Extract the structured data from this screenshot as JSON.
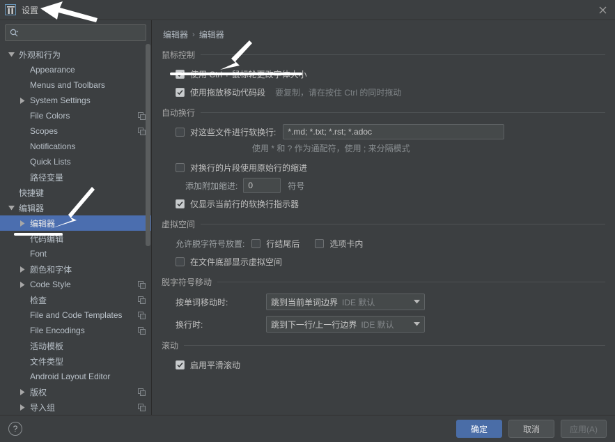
{
  "window": {
    "title": "设置",
    "logo_icon": "jetbrains-logo-icon",
    "close_icon": "close-icon"
  },
  "sidebar": {
    "search": {
      "value": "",
      "placeholder": "",
      "icon": "search-icon"
    },
    "items": [
      {
        "label": "外观和行为",
        "depth": 0,
        "twisty": "down",
        "copy": false
      },
      {
        "label": "Appearance",
        "depth": 1,
        "twisty": "none",
        "copy": false
      },
      {
        "label": "Menus and Toolbars",
        "depth": 1,
        "twisty": "none",
        "copy": false
      },
      {
        "label": "System Settings",
        "depth": 1,
        "twisty": "right",
        "copy": false
      },
      {
        "label": "File Colors",
        "depth": 1,
        "twisty": "none",
        "copy": true
      },
      {
        "label": "Scopes",
        "depth": 1,
        "twisty": "none",
        "copy": true
      },
      {
        "label": "Notifications",
        "depth": 1,
        "twisty": "none",
        "copy": false
      },
      {
        "label": "Quick Lists",
        "depth": 1,
        "twisty": "none",
        "copy": false
      },
      {
        "label": "路径变量",
        "depth": 1,
        "twisty": "none",
        "copy": false
      },
      {
        "label": "快捷键",
        "depth": 0,
        "twisty": "none",
        "copy": false
      },
      {
        "label": "编辑器",
        "depth": 0,
        "twisty": "down",
        "copy": false
      },
      {
        "label": "编辑器",
        "depth": 1,
        "twisty": "right",
        "copy": false,
        "selected": true
      },
      {
        "label": "代码编辑",
        "depth": 1,
        "twisty": "none",
        "copy": false
      },
      {
        "label": "Font",
        "depth": 1,
        "twisty": "none",
        "copy": false
      },
      {
        "label": "颜色和字体",
        "depth": 1,
        "twisty": "right",
        "copy": false
      },
      {
        "label": "Code Style",
        "depth": 1,
        "twisty": "right",
        "copy": true
      },
      {
        "label": "检查",
        "depth": 1,
        "twisty": "none",
        "copy": true
      },
      {
        "label": "File and Code Templates",
        "depth": 1,
        "twisty": "none",
        "copy": true
      },
      {
        "label": "File Encodings",
        "depth": 1,
        "twisty": "none",
        "copy": true
      },
      {
        "label": "活动模板",
        "depth": 1,
        "twisty": "none",
        "copy": false
      },
      {
        "label": "文件类型",
        "depth": 1,
        "twisty": "none",
        "copy": false
      },
      {
        "label": "Android Layout Editor",
        "depth": 1,
        "twisty": "none",
        "copy": false
      },
      {
        "label": "版权",
        "depth": 1,
        "twisty": "right",
        "copy": true
      },
      {
        "label": "导入组",
        "depth": 1,
        "twisty": "right",
        "copy": true
      }
    ]
  },
  "content": {
    "breadcrumb": {
      "root": "编辑器",
      "separator": "›",
      "current": "编辑器"
    },
    "mouse_section": {
      "title": "鼠标控制",
      "ctrl_wheel": {
        "label": "使用 Ctrl + 鼠标轮更改字体大小",
        "checked": true
      },
      "drag_drop": {
        "label": "使用拖放移动代码段",
        "checked": true,
        "hint": "要复制，请在按住 Ctrl 的同时拖动"
      }
    },
    "softwrap_section": {
      "title": "自动换行",
      "soft_wrap_files": {
        "label": "对这些文件进行软换行:",
        "checked": false,
        "value": "*.md; *.txt; *.rst; *.adoc"
      },
      "wildcard_hint": "使用 * 和 ? 作为通配符，使用 ; 来分隔模式",
      "use_original_indent": {
        "label": "对换行的片段使用原始行的缩进",
        "checked": false
      },
      "additional_indent": {
        "label": "添加附加缩进:",
        "value": "0",
        "unit": "符号"
      },
      "show_indicator": {
        "label": "仅显示当前行的软换行指示器",
        "checked": true
      }
    },
    "virtual_space_section": {
      "title": "虚拟空间",
      "allow_caret_label": "允许脱字符号放置:",
      "after_line_end": {
        "label": "行结尾后",
        "checked": false
      },
      "inside_tabs": {
        "label": "选项卡内",
        "checked": false
      },
      "show_virtual_space": {
        "label": "在文件底部显示虚拟空间",
        "checked": false
      }
    },
    "caret_section": {
      "title": "脱字符号移动",
      "word_move": {
        "label": "按单词移动时:",
        "value": "跳到当前单词边界",
        "suffix": "IDE 默认",
        "caret_icon": "chevron-down-icon"
      },
      "line_move": {
        "label": "换行时:",
        "value": "跳到下一行/上一行边界",
        "suffix": "IDE 默认",
        "caret_icon": "chevron-down-icon"
      }
    },
    "scroll_section": {
      "title": "滚动",
      "smooth_scroll": {
        "label": "启用平滑滚动",
        "checked": true
      }
    }
  },
  "footer": {
    "help_icon": "help-icon",
    "help_label": "?",
    "ok": "确定",
    "cancel": "取消",
    "apply": "应用(A)"
  },
  "colors": {
    "selection": "#4b6eaf",
    "primary_button": "#4a6da7",
    "window_bg": "#3c3f41",
    "annotation": "#ffffff"
  }
}
